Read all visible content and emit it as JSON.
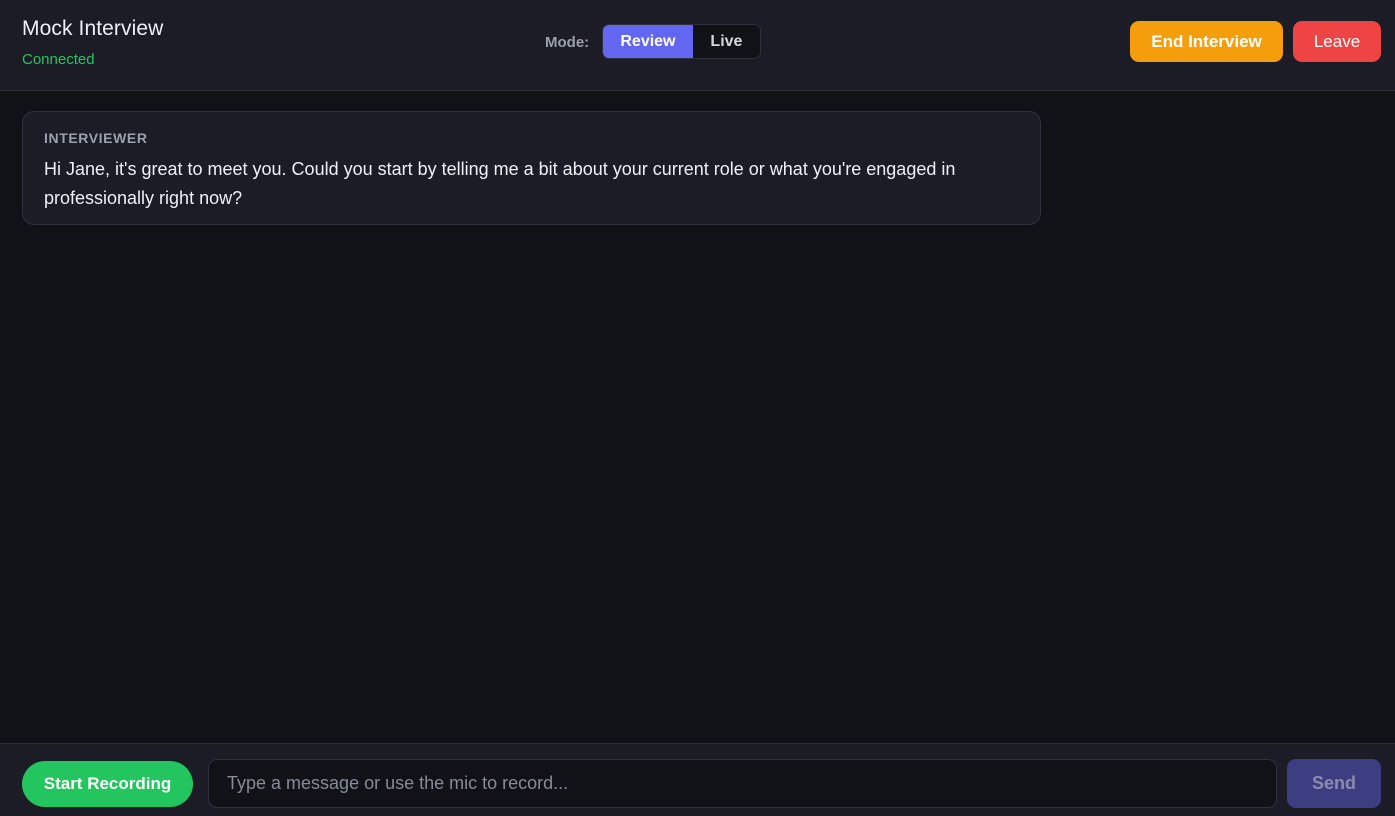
{
  "header": {
    "title": "Mock Interview",
    "status": "Connected",
    "mode_label": "Mode:",
    "modes": [
      "Review",
      "Live"
    ],
    "selected_mode": "Review",
    "end_label": "End Interview",
    "leave_label": "Leave"
  },
  "messages": [
    {
      "role": "INTERVIEWER",
      "text": "Hi Jane, it's great to meet you. Could you start by telling me a bit about your current role or what you're engaged in professionally right now?"
    }
  ],
  "footer": {
    "record_label": "Start Recording",
    "input_placeholder": "Type a message or use the mic to record...",
    "input_value": "",
    "send_label": "Send"
  },
  "colors": {
    "background": "#111217",
    "panel": "#1b1c25",
    "accent": "#6366f1",
    "connected": "#22c55e",
    "end_button": "#f59e0b",
    "leave_button": "#ef4444",
    "record_button": "#22c55e",
    "send_button_disabled": "#3d3e82"
  }
}
